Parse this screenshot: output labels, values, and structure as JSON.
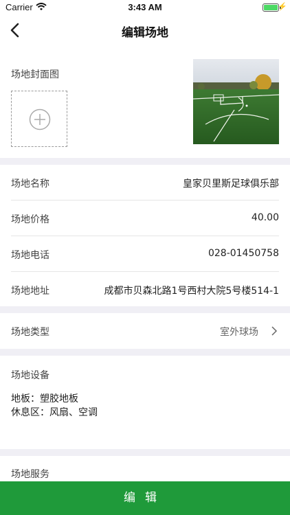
{
  "status_bar": {
    "carrier": "Carrier",
    "time": "3:43 AM",
    "battery_level": 1.0
  },
  "nav": {
    "title": "编辑场地",
    "back_icon": "chevron-left-icon"
  },
  "cover": {
    "label": "场地封面图",
    "upload_icon": "plus-circle-icon"
  },
  "info_rows": [
    {
      "label": "场地名称",
      "value": "皇家贝里斯足球俱乐部"
    },
    {
      "label": "场地价格",
      "value": "40.00"
    },
    {
      "label": "场地电话",
      "value": "028-01450758"
    },
    {
      "label": "场地地址",
      "value": "成都市贝森北路1号西村大院5号楼514-1"
    }
  ],
  "venue_type": {
    "label": "场地类型",
    "value": "室外球场",
    "icon": "chevron-right-icon"
  },
  "equipment": {
    "title": "场地设备",
    "lines": [
      "地板：塑胶地板",
      "休息区：风扇、空调"
    ]
  },
  "service": {
    "title": "场地服务"
  },
  "edit_button": {
    "label": "编辑"
  },
  "colors": {
    "primary": "#1f9a3a",
    "background": "#f0eff5",
    "battery": "#4cd964"
  }
}
